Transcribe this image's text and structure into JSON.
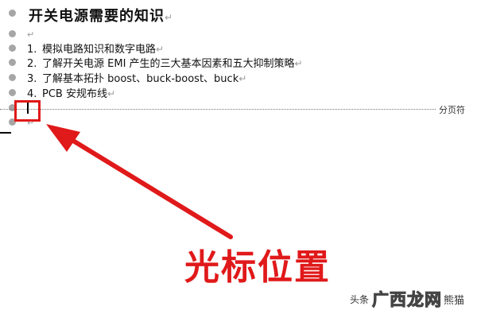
{
  "document": {
    "title": "开关电源需要的知识",
    "paragraph_mark": "↵",
    "list_items": [
      {
        "number": "1.",
        "text": "模拟电路知识和数字电路"
      },
      {
        "number": "2.",
        "text": "了解开关电源 EMI 产生的三大基本因素和五大抑制策略"
      },
      {
        "number": "3.",
        "text": "了解基本拓扑 boost、buck-boost、buck"
      },
      {
        "number": "4.",
        "text": "PCB 安规布线"
      }
    ],
    "page_break_label": "分页符"
  },
  "annotation": {
    "caption": "光标位置",
    "color": "#e0191a"
  },
  "watermark": {
    "prefix": "头条",
    "logo": "广西龙网",
    "suffix": "熊猫"
  }
}
